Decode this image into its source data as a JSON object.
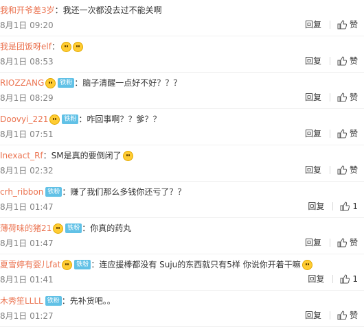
{
  "comments": [
    {
      "user": "我和开爷差3岁",
      "badge": "",
      "text": "：我还一次都没去过不能关啊",
      "emoji": false,
      "time": "8月1日 09:20",
      "reply": "回复",
      "like": "赞"
    },
    {
      "user": "我是团饭呀elf",
      "badge": "",
      "text": "：",
      "emoji": true,
      "time": "8月1日 08:53",
      "reply": "回复",
      "like": "赞"
    },
    {
      "user": "RIOZZANG",
      "badge": "铁粉",
      "text": "：脑子清醒一点好不好？？？",
      "emoji": false,
      "time": "8月1日 08:29",
      "reply": "回复",
      "like": "赞"
    },
    {
      "user": "Doovyi_221",
      "badge": "铁粉",
      "text": "：咋回事啊？？爹？？",
      "emoji": false,
      "time": "8月1日 07:51",
      "reply": "回复",
      "like": "赞"
    },
    {
      "user": "Inexact_Rf",
      "badge": "",
      "text": "：SM是真的要倒闭了",
      "emoji": true,
      "time": "8月1日 02:32",
      "reply": "回复",
      "like": "赞"
    },
    {
      "user": "crh_ribbon",
      "badge": "铁粉",
      "text": "：赚了我们那么多钱你还亏了？？",
      "emoji": false,
      "time": "8月1日 01:47",
      "reply": "回复",
      "like": "1"
    },
    {
      "user": "薄荷味的猪21",
      "badge": "铁粉",
      "text": "：你真的药丸",
      "emoji": false,
      "time": "8月1日 01:47",
      "reply": "回复",
      "like": "赞"
    },
    {
      "user": "夏雪婷有婴儿fat",
      "badge": "铁粉",
      "text": "：连应援棒都没有 Suju的东西就只有5样 你说你开着干嘛",
      "emoji": true,
      "time": "8月1日 01:41",
      "reply": "回复",
      "like": "1"
    },
    {
      "user": "木秀笙LLLL",
      "badge": "铁粉",
      "text": "：先补货吧。。",
      "emoji": false,
      "time": "8月1日 01:27",
      "reply": "回复",
      "like": "赞"
    }
  ],
  "colors": {
    "username": "#eb7350",
    "badge_bg": "#61c1e6",
    "time": "#808080"
  }
}
